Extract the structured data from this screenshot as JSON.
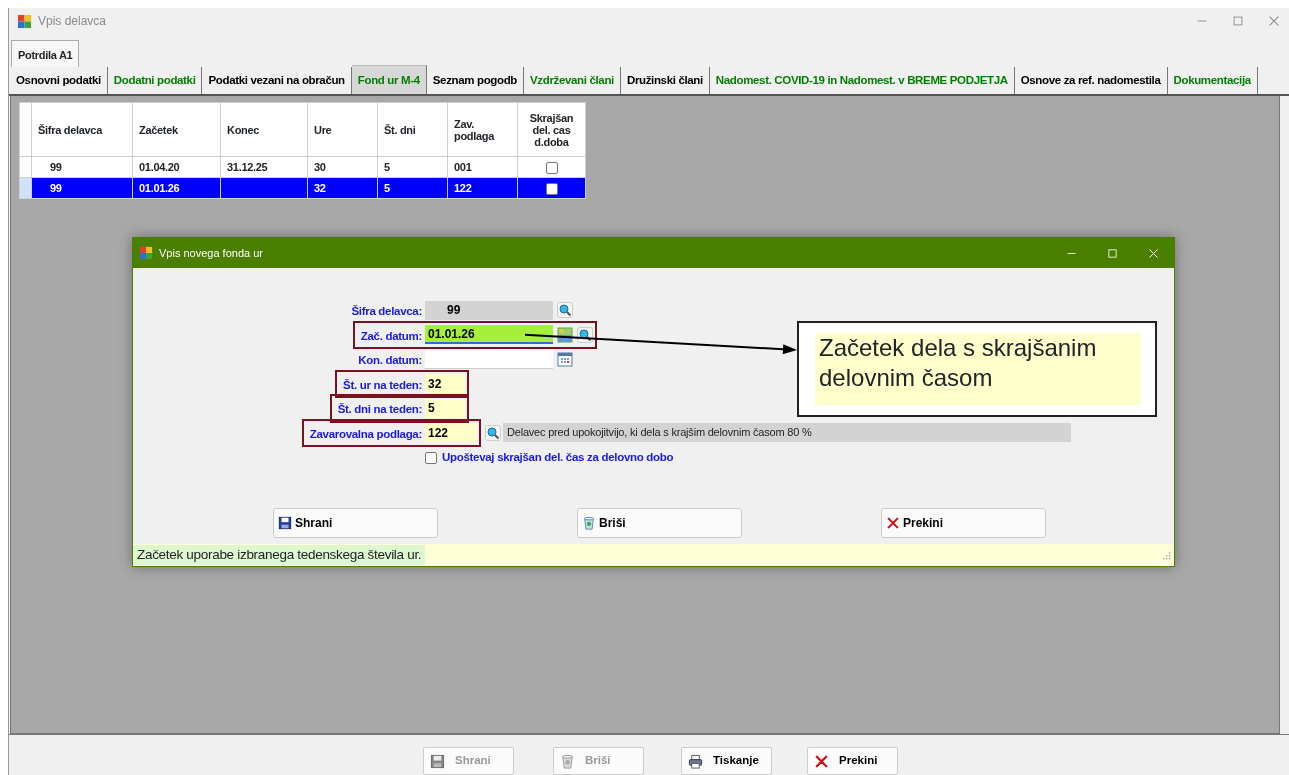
{
  "window": {
    "title": "Vpis delavca"
  },
  "outer_tabs": [
    {
      "label": "Potrdila A1",
      "selected": true
    }
  ],
  "tabs": [
    {
      "label": "Osnovni podatki",
      "selected": false,
      "color": "#000000"
    },
    {
      "label": "Dodatni podatki",
      "selected": false,
      "color": "#008000"
    },
    {
      "label": "Podatki vezani na obračun",
      "selected": false,
      "color": "#000000"
    },
    {
      "label": "Fond ur M-4",
      "selected": true,
      "color": "#008000"
    },
    {
      "label": "Seznam pogodb",
      "selected": false,
      "color": "#000000"
    },
    {
      "label": "Vzdrževani člani",
      "selected": false,
      "color": "#008000"
    },
    {
      "label": "Družinski člani",
      "selected": false,
      "color": "#000000"
    },
    {
      "label": "Nadomest. COVID-19  in Nadomest. v BREME PODJETJA",
      "selected": false,
      "color": "#008000"
    },
    {
      "label": "Osnove za ref.  nadomestila",
      "selected": false,
      "color": "#000000"
    },
    {
      "label": "Dokumentacija",
      "selected": false,
      "color": "#008000"
    }
  ],
  "table": {
    "columns": [
      "Šifra delavca",
      "Začetek",
      "Konec",
      "Ure",
      "Št. dni",
      "Zav. podlaga",
      "Skrajšan del. cas d.doba"
    ],
    "rows": [
      {
        "cells": [
          "99",
          "01.04.20",
          "31.12.25",
          "30",
          "5",
          "001"
        ],
        "checked": false,
        "selected": false
      },
      {
        "cells": [
          "99",
          "01.01.26",
          "",
          "32",
          "5",
          "122"
        ],
        "checked": false,
        "selected": true
      }
    ]
  },
  "dialog": {
    "title": "Vpis novega fonda ur",
    "fields": [
      {
        "label": "Šifra delavca:",
        "value": "99",
        "kind": "code",
        "highlighted": false,
        "focused": false
      },
      {
        "label": "Zač. datum:",
        "value": "01.01.26",
        "kind": "date-lookup",
        "highlighted": true,
        "focused": true
      },
      {
        "label": "Kon. datum:",
        "kind": "date",
        "highlighted": false,
        "focused": false
      },
      {
        "label": "Št. ur na teden:",
        "value": "32",
        "kind": "number",
        "highlighted": true,
        "focused": false
      },
      {
        "label": "Št. dni na teden:",
        "value": "5",
        "kind": "number",
        "highlighted": true,
        "focused": false
      },
      {
        "label": "Zavarovalna podlaga:",
        "value": "122",
        "kind": "code-number",
        "highlighted": true,
        "focused": false,
        "description": "Delavec pred upokojitvijo, ki dela s krajšim delovnim časom 80 %"
      }
    ],
    "checkbox": {
      "label": "Upoštevaj skrajšan del. čas za delovno dobo",
      "checked": false
    },
    "buttons": [
      {
        "label": "Shrani",
        "kind": "save"
      },
      {
        "label": "Briši",
        "kind": "delete"
      },
      {
        "label": "Prekini",
        "kind": "cancel"
      }
    ],
    "status": "Začetek uporabe izbranega tedenskega števila ur."
  },
  "callout": {
    "text": "Začetek dela s skrajšanim delovnim  časom"
  },
  "bottom_buttons": [
    {
      "label": "Shrani",
      "kind": "save",
      "disabled": true
    },
    {
      "label": "Briši",
      "kind": "delete",
      "disabled": true
    },
    {
      "label": "Tiskanje",
      "kind": "print",
      "disabled": false
    },
    {
      "label": "Prekini",
      "kind": "cancel",
      "disabled": false
    }
  ]
}
